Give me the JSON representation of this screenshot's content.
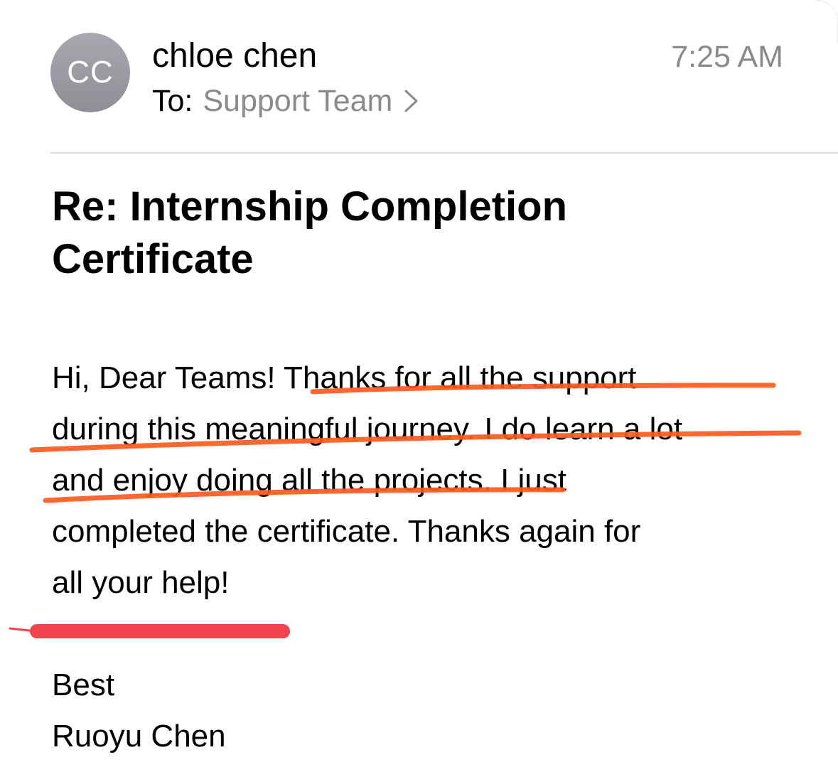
{
  "sender": {
    "initials": "CC",
    "name": "chloe chen",
    "time": "7:25 AM"
  },
  "recipient": {
    "label": "To:",
    "name": "Support Team"
  },
  "subject": {
    "line1": "Re: Internship Completion",
    "line2": "Certificate"
  },
  "message": {
    "lines": [
      "Hi, Dear Teams! Thanks for all the support",
      "during this meaningful journey. I do learn a lot",
      "and enjoy doing all the projects. I just",
      "completed the certificate. Thanks again for",
      "all your help!"
    ]
  },
  "signature": {
    "closing": "Best",
    "name": "Ruoyu Chen"
  },
  "annotation_colors": {
    "underline": "#ff5a1f",
    "signature_mark": "#f2434e"
  }
}
